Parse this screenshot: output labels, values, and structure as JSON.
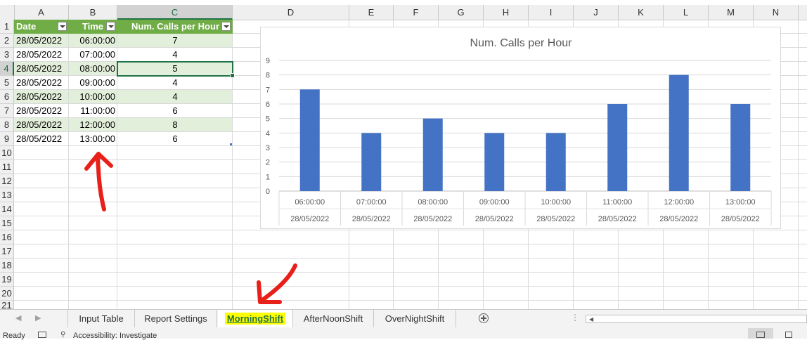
{
  "columns": [
    "A",
    "B",
    "C",
    "D",
    "E",
    "F",
    "G",
    "H",
    "I",
    "J",
    "K",
    "L",
    "M",
    "N"
  ],
  "rows": [
    "1",
    "2",
    "3",
    "4",
    "5",
    "6",
    "7",
    "8",
    "9",
    "10",
    "11",
    "12",
    "13",
    "14",
    "15",
    "16",
    "17",
    "18",
    "19",
    "20",
    "21"
  ],
  "table": {
    "headers": [
      "Date",
      "Time",
      "Num. Calls per Hour"
    ],
    "rows": [
      [
        "28/05/2022",
        "06:00:00",
        "7"
      ],
      [
        "28/05/2022",
        "07:00:00",
        "4"
      ],
      [
        "28/05/2022",
        "08:00:00",
        "5"
      ],
      [
        "28/05/2022",
        "09:00:00",
        "4"
      ],
      [
        "28/05/2022",
        "10:00:00",
        "4"
      ],
      [
        "28/05/2022",
        "11:00:00",
        "6"
      ],
      [
        "28/05/2022",
        "12:00:00",
        "8"
      ],
      [
        "28/05/2022",
        "13:00:00",
        "6"
      ]
    ]
  },
  "chart_data": {
    "type": "bar",
    "title": "Num. Calls per Hour",
    "categories": [
      "06:00:00",
      "07:00:00",
      "08:00:00",
      "09:00:00",
      "10:00:00",
      "11:00:00",
      "12:00:00",
      "13:00:00"
    ],
    "category_group": "28/05/2022",
    "values": [
      7,
      4,
      5,
      4,
      4,
      6,
      8,
      6
    ],
    "ylim": [
      0,
      9
    ],
    "yticks": [
      "0",
      "1",
      "2",
      "3",
      "4",
      "5",
      "6",
      "7",
      "8",
      "9"
    ],
    "grid": true,
    "color": "#4472c4"
  },
  "sheet_tabs": [
    "Input Table",
    "Report Settings",
    "MorningShift",
    "AfterNoonShift",
    "OverNightShift"
  ],
  "active_tab": "MorningShift",
  "status": {
    "ready": "Ready",
    "accessibility": "Accessibility: Investigate"
  },
  "colors": {
    "header_green": "#70ad47",
    "band_green": "#e2efda",
    "selection": "#217346",
    "bar_blue": "#4472c4",
    "annotation_red": "#e8201a",
    "tab_highlight": "#ffff00"
  }
}
